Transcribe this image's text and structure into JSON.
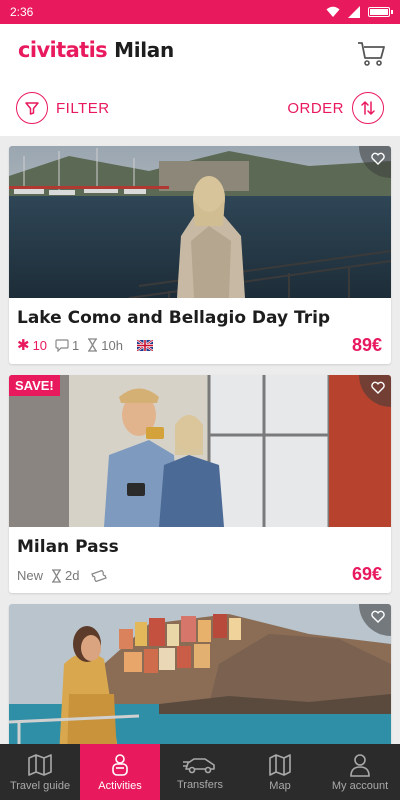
{
  "status_bar": {
    "time": "2:36"
  },
  "header": {
    "brand": "civitatis",
    "city": "Milan",
    "filter_label": "FILTER",
    "order_label": "ORDER"
  },
  "cards": [
    {
      "title": "Lake Como and Bellagio Day Trip",
      "rating": "10",
      "comments": "1",
      "duration": "10h",
      "language_icon": "uk-flag-icon",
      "price": "89€"
    },
    {
      "badge": "SAVE!",
      "title": "Milan Pass",
      "label": "New",
      "duration": "2d",
      "ticket_icon": "ticket-icon",
      "price": "69€"
    },
    {
      "image_icon": "cinque-terre-photo"
    }
  ],
  "bottom_nav": [
    {
      "label": "Travel guide",
      "icon": "map-book-icon"
    },
    {
      "label": "Activities",
      "icon": "person-icon",
      "active": true
    },
    {
      "label": "Transfers",
      "icon": "car-icon"
    },
    {
      "label": "Map",
      "icon": "map-icon"
    },
    {
      "label": "My account",
      "icon": "user-icon"
    }
  ],
  "colors": {
    "brand": "#e8195d",
    "nav_bg": "#2b2b2b"
  }
}
